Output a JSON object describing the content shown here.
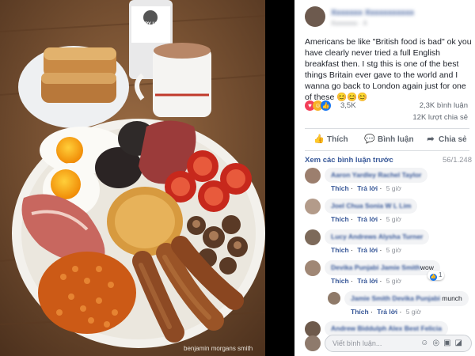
{
  "photo": {
    "credit": "benjamin morgans smith",
    "bottle_label": "FRY UP POLICE"
  },
  "post": {
    "text": "Americans be like \"British food is bad\" ok you have clearly never tried a full English breakfast then. I stg this is one of the best things Britain ever gave to the world and I wanna go back to London again just for one of these 😊😊😊",
    "reactions_count": "3,5K",
    "comments_count": "2,3K bình luận",
    "shares_count": "12K lượt chia sẻ"
  },
  "actions": {
    "like": "Thích",
    "comment": "Bình luận",
    "share": "Chia sẻ"
  },
  "more_comments": {
    "label": "Xem các bình luận trước",
    "count": "56/1.248"
  },
  "comment_labels": {
    "like": "Thích",
    "reply": "Trả lời",
    "time": "5 giờ"
  },
  "comments": [
    {
      "names": "Aaron Yardley Rachel Taylor",
      "text": ""
    },
    {
      "names": "Joel Chua Sonia W L Lim",
      "text": ""
    },
    {
      "names": "Lucy Andrews Alysha Turner",
      "text": ""
    },
    {
      "names": "Devika Punjabi Jamie Smith",
      "text": "wow",
      "badge": "1"
    },
    {
      "names": "Jamie Smith Devika Punjabi",
      "text": " munch"
    },
    {
      "names": "Andrew Biddulph Alex Best Felicia",
      "text": ""
    }
  ],
  "input": {
    "placeholder": "Viết bình luận..."
  }
}
